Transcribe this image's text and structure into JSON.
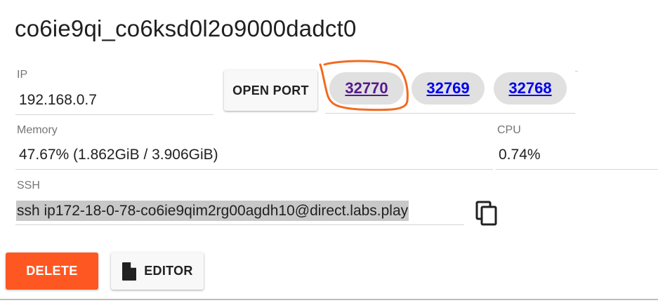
{
  "session": {
    "title": "co6ie9qi_co6ksd0l2o9000dadct0"
  },
  "ip": {
    "label": "IP",
    "value": "192.168.0.7"
  },
  "ports": {
    "open_port_label": "OPEN PORT",
    "items": [
      "32770",
      "32769",
      "32768"
    ]
  },
  "memory": {
    "label": "Memory",
    "value": "47.67% (1.862GiB / 3.906GiB)"
  },
  "cpu": {
    "label": "CPU",
    "value": "0.74%"
  },
  "ssh": {
    "label": "SSH",
    "value": "ssh ip172-18-0-78-co6ie9qim2rg00agdh10@direct.labs.play"
  },
  "actions": {
    "delete_label": "DELETE",
    "editor_label": "EDITOR"
  },
  "colors": {
    "delete_bg": "#ff5722",
    "chip_bg": "#e0e0e0",
    "link": "#0000ee",
    "link_visited": "#551a8b",
    "annotation": "#f26a21"
  },
  "icons": {
    "copy": "copy-icon",
    "editor": "file-icon"
  }
}
